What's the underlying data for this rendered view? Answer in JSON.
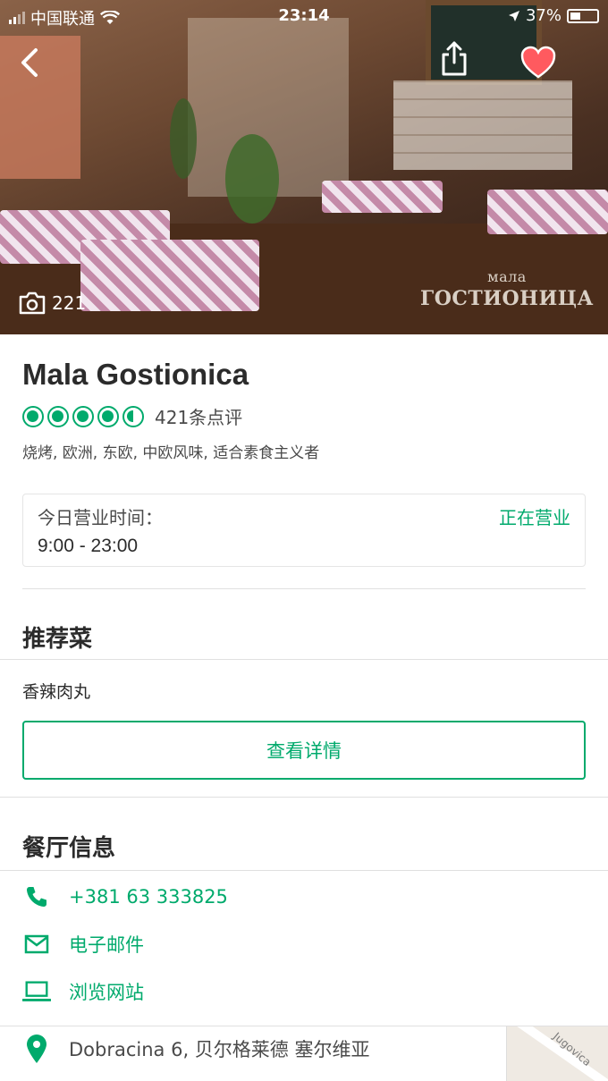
{
  "status_bar": {
    "carrier": "中国联通",
    "time": "23:14",
    "battery": "37%"
  },
  "hero": {
    "photo_count": "221",
    "watermark_top": "мала",
    "watermark_bottom": "ГОСТИОНИЦА"
  },
  "restaurant": {
    "name": "Mala Gostionica",
    "rating": 4.5,
    "review_count": "421条点评",
    "cuisines": "烧烤, 欧洲, 东欧, 中欧风味, 适合素食主义者"
  },
  "hours": {
    "label": "今日营业时间：",
    "value": "9:00 - 23:00",
    "status": "正在营业"
  },
  "recommended": {
    "heading": "推荐菜",
    "dish": "香辣肉丸",
    "button_label": "查看详情"
  },
  "info": {
    "heading": "餐厅信息",
    "phone": "+381 63 333825",
    "email_label": "电子邮件",
    "website_label": "浏览网站",
    "address": "Dobracina 6, 贝尔格莱德 塞尔维亚"
  },
  "map": {
    "street_label": "Jugovica"
  },
  "colors": {
    "accent": "#00aa6c",
    "text": "#2b2b2b",
    "muted": "#4a4a4a",
    "heart": "#ff5a5f"
  },
  "icons": {
    "back": "chevron-left-icon",
    "share": "share-icon",
    "favorite": "heart-icon",
    "camera": "camera-icon",
    "phone": "phone-icon",
    "email": "envelope-icon",
    "website": "laptop-icon",
    "address": "map-pin-icon"
  }
}
